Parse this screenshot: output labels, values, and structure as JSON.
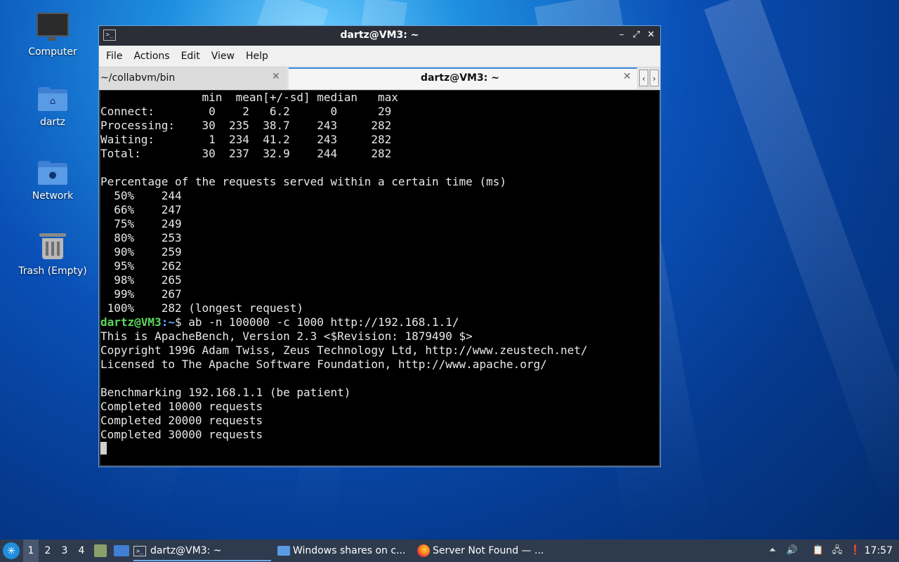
{
  "desktop": {
    "icons": [
      {
        "label": "Computer"
      },
      {
        "label": "dartz"
      },
      {
        "label": "Network"
      },
      {
        "label": "Trash (Empty)"
      }
    ]
  },
  "window": {
    "title": "dartz@VM3: ~",
    "menu": [
      "File",
      "Actions",
      "Edit",
      "View",
      "Help"
    ],
    "tabs": [
      {
        "label": "~/collabvm/bin",
        "active": false
      },
      {
        "label": "dartz@VM3: ~",
        "active": true
      }
    ],
    "terminal": {
      "lines_top": [
        "               min  mean[+/-sd] median   max",
        "Connect:        0    2   6.2      0      29",
        "Processing:    30  235  38.7    243     282",
        "Waiting:        1  234  41.2    243     282",
        "Total:         30  237  32.9    244     282",
        "",
        "Percentage of the requests served within a certain time (ms)",
        "  50%    244",
        "  66%    247",
        "  75%    249",
        "  80%    253",
        "  90%    259",
        "  95%    262",
        "  98%    265",
        "  99%    267",
        " 100%    282 (longest request)"
      ],
      "prompt_user": "dartz@VM3",
      "prompt_path": ":~",
      "prompt_command": "$ ab -n 100000 -c 1000 http://192.168.1.1/",
      "lines_bottom": [
        "This is ApacheBench, Version 2.3 <$Revision: 1879490 $>",
        "Copyright 1996 Adam Twiss, Zeus Technology Ltd, http://www.zeustech.net/",
        "Licensed to The Apache Software Foundation, http://www.apache.org/",
        "",
        "Benchmarking 192.168.1.1 (be patient)",
        "Completed 10000 requests",
        "Completed 20000 requests",
        "Completed 30000 requests"
      ]
    }
  },
  "taskbar": {
    "workspaces": [
      "1",
      "2",
      "3",
      "4"
    ],
    "active_workspace": "1",
    "tasks": [
      {
        "label": "dartz@VM3: ~",
        "icon": "terminal-icon",
        "active": true
      },
      {
        "label": "Windows shares on c...",
        "icon": "folder-icon",
        "active": false
      },
      {
        "label": "Server Not Found — ...",
        "icon": "firefox-icon",
        "active": false
      }
    ],
    "clock": "17:57"
  }
}
